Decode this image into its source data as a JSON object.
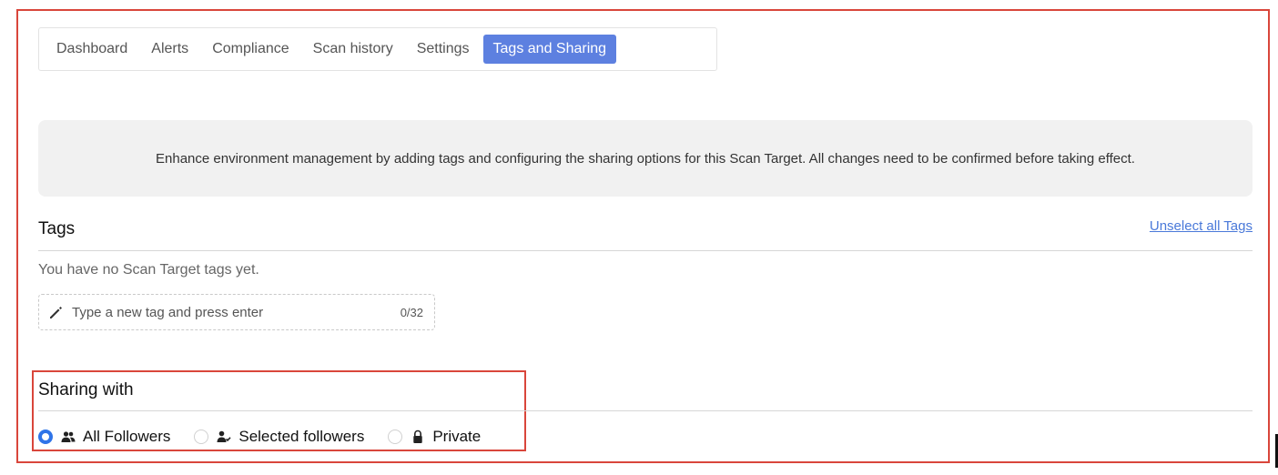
{
  "tabs": [
    {
      "label": "Dashboard",
      "active": false
    },
    {
      "label": "Alerts",
      "active": false
    },
    {
      "label": "Compliance",
      "active": false
    },
    {
      "label": "Scan history",
      "active": false
    },
    {
      "label": "Settings",
      "active": false
    },
    {
      "label": "Tags and Sharing",
      "active": true
    }
  ],
  "info_text": "Enhance environment management by adding tags and configuring the sharing options for this Scan Target. All changes need to be confirmed before taking effect.",
  "tags": {
    "title": "Tags",
    "unselect_label": "Unselect all Tags",
    "empty_text": "You have no Scan Target tags yet.",
    "input_value": "",
    "input_placeholder": "Type a new tag and press enter",
    "counter": "0/32"
  },
  "sharing": {
    "title": "Sharing with",
    "options": [
      {
        "label": "All Followers",
        "icon": "group-icon",
        "checked": true
      },
      {
        "label": "Selected followers",
        "icon": "user-check-icon",
        "checked": false
      },
      {
        "label": "Private",
        "icon": "lock-icon",
        "checked": false
      }
    ]
  },
  "colors": {
    "accent": "#5d80e0",
    "radio_selected": "#2f74e8",
    "link": "#4a79d9",
    "highlight_border": "#d9463b"
  }
}
